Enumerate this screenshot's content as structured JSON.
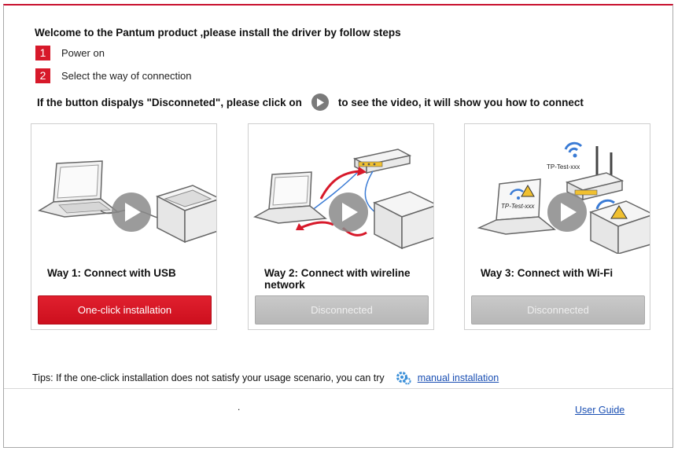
{
  "header": {
    "welcome": "Welcome to the Pantum product ,please install the driver by follow steps",
    "steps": [
      {
        "num": "1",
        "label": "Power on"
      },
      {
        "num": "2",
        "label": "Select the way of connection"
      }
    ],
    "notice_before": "If the button dispalys \"Disconneted\", please click on",
    "notice_after": "to see the video, it will show you how to connect"
  },
  "cards": [
    {
      "way": "Way 1: Connect with USB",
      "button": "One-click installation"
    },
    {
      "way": "Way 2: Connect with wireline network",
      "button": "Disconnected"
    },
    {
      "way": "Way 3: Connect with Wi-Fi",
      "button": "Disconnected",
      "wifi_label_router": "TP-Test-xxx",
      "wifi_label_laptop": "TP-Test-xxx"
    }
  ],
  "tips": {
    "text": "Tips: If the one-click installation does not satisfy your usage scenario, you can try",
    "link": "manual installation"
  },
  "footer": {
    "dot": ".",
    "user_guide": "User Guide"
  },
  "colors": {
    "accent": "#d7192a",
    "link": "#1a4fb3",
    "disabled": "#bdbdbd"
  },
  "icons": [
    "play-icon",
    "gear-icon",
    "wifi-icon",
    "warning-icon"
  ]
}
